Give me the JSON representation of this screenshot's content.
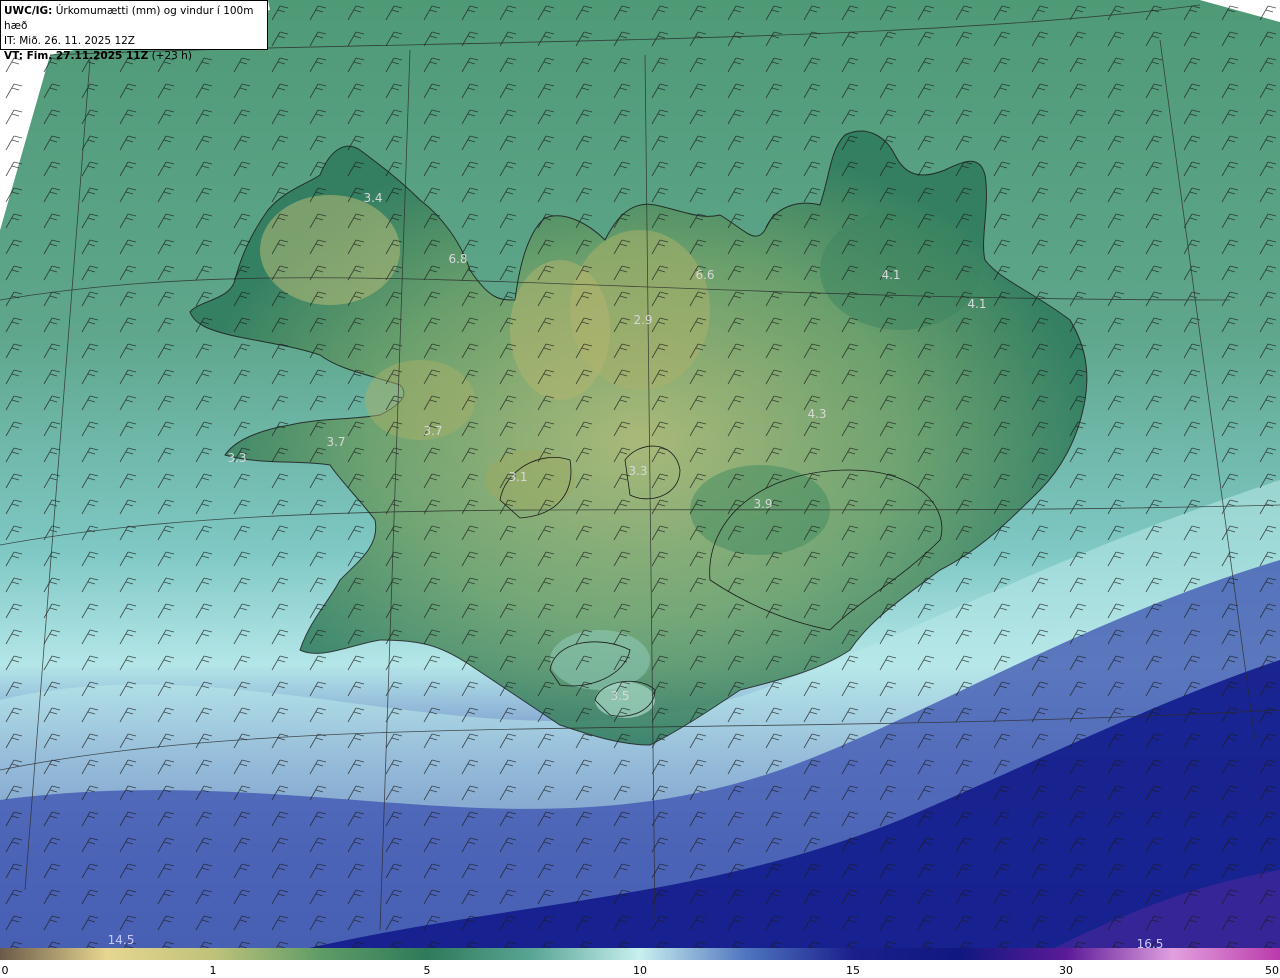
{
  "header": {
    "product": "UWC/IG:",
    "field": "Úrkomumætti (mm) og vindur í 100m hæð",
    "init_time": "IT: Mið. 26. 11. 2025 12Z",
    "valid_label": "VT: Fim. 27.11.2025 11Z",
    "valid_offset": "(+23 h)"
  },
  "map_labels": [
    {
      "id": "westfjords-north",
      "text": "3.4"
    },
    {
      "id": "westfjords-east",
      "text": "6.8"
    },
    {
      "id": "north-central",
      "text": "6.6"
    },
    {
      "id": "north-center-small",
      "text": "2.9"
    },
    {
      "id": "northeast-1",
      "text": "4.1"
    },
    {
      "id": "northeast-2",
      "text": "4.1"
    },
    {
      "id": "central-east",
      "text": "4.3"
    },
    {
      "id": "snaefellsnes-tip",
      "text": "3.3"
    },
    {
      "id": "snaefellsnes",
      "text": "3.7"
    },
    {
      "id": "west-inland",
      "text": "3.7"
    },
    {
      "id": "langjokull",
      "text": "3.1"
    },
    {
      "id": "hofsjokull",
      "text": "3.3"
    },
    {
      "id": "vatnajokull",
      "text": "3.9"
    },
    {
      "id": "myrdalsjokull",
      "text": "3.5"
    },
    {
      "id": "sw-ocean",
      "text": "14.5"
    },
    {
      "id": "se-ocean",
      "text": "16.5"
    }
  ],
  "colorbar": {
    "ticks": [
      "0",
      "1",
      "5",
      "10",
      "15",
      "30",
      "50"
    ],
    "colors": [
      "#6b5a48",
      "#e6d690",
      "#bfc27a",
      "#5f9c66",
      "#2f7a5a",
      "#5aa696",
      "#c8f0ee",
      "#4f74bf",
      "#1a1f8c",
      "#101880",
      "#5b1a98",
      "#e2a0df",
      "#ba3aaa"
    ]
  },
  "icons": [
    "wind-barb-icon"
  ]
}
